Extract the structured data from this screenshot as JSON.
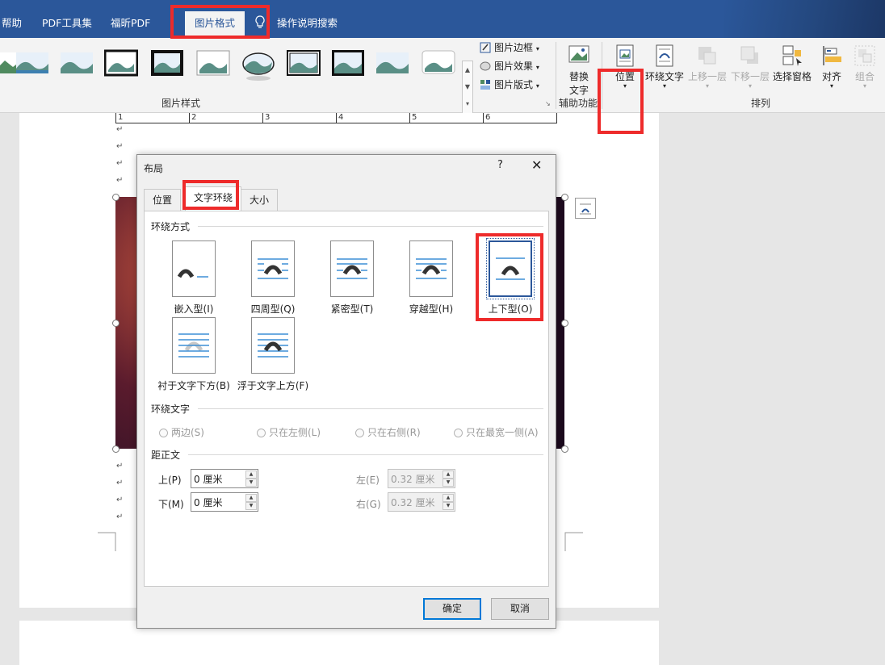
{
  "ribbon": {
    "tabs": [
      "帮助",
      "PDF工具集",
      "福昕PDF",
      "图片格式",
      "操作说明搜索"
    ],
    "picture_styles_label": "图片样式",
    "picture_border": "图片边框",
    "picture_effects": "图片效果",
    "picture_layout": "图片版式",
    "alt_text": [
      "替换",
      "文字"
    ],
    "accessibility_label": "辅助功能",
    "position": "位置",
    "wrap_text": "环绕文字",
    "bring_forward": "上移一层",
    "send_backward": "下移一层",
    "selection_pane": "选择窗格",
    "align": "对齐",
    "group": "组合",
    "arrange_label": "排列"
  },
  "document": {
    "table_cells": [
      "1",
      "2",
      "3",
      "4",
      "5",
      "6"
    ]
  },
  "dialog": {
    "title": "布局",
    "help": "?",
    "close": "✕",
    "tabs": [
      "位置",
      "文字环绕",
      "大小"
    ],
    "wrap_section": "环绕方式",
    "wrap_options": [
      "嵌入型(I)",
      "四周型(Q)",
      "紧密型(T)",
      "穿越型(H)",
      "上下型(O)",
      "衬于文字下方(B)",
      "浮于文字上方(F)"
    ],
    "wrap_text_section": "环绕文字",
    "wrap_text_options": [
      "两边(S)",
      "只在左侧(L)",
      "只在右侧(R)",
      "只在最宽一侧(A)"
    ],
    "distance_section": "距正文",
    "top_label": "上(P)",
    "top_value": "0 厘米",
    "bottom_label": "下(M)",
    "bottom_value": "0 厘米",
    "left_label": "左(E)",
    "left_value": "0.32 厘米",
    "right_label": "右(G)",
    "right_value": "0.32 厘米",
    "ok": "确定",
    "cancel": "取消"
  },
  "colors": {
    "accent": "#2b579a",
    "highlight": "#ee2b2b",
    "wrap_line": "#3d8fd6"
  }
}
